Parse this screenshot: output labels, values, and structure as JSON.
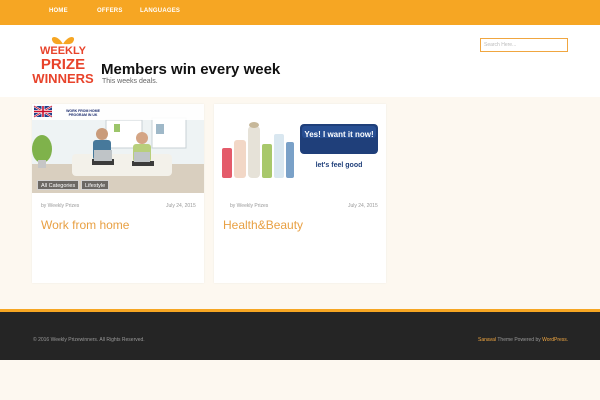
{
  "nav": {
    "items": [
      {
        "label": "HOME"
      },
      {
        "label": "OFFERS"
      },
      {
        "label": "LANGUAGES"
      }
    ]
  },
  "header": {
    "logo": {
      "line1": "WEEKLY",
      "line2": "PRIZE",
      "line3": "WINNERS"
    },
    "title": "Members win every week",
    "tagline": "This weeks deals.",
    "search_placeholder": "Search Here..."
  },
  "posts": [
    {
      "image_caption": "WORK FROM HOME PROGRAM IN UK",
      "categories": [
        "All Categories",
        "Lifestyle"
      ],
      "author": "by Weekly Prizes",
      "date": "July 24, 2015",
      "title": "Work from home"
    },
    {
      "image_cta_main": "Yes! I want it now!",
      "image_cta_sub": "let's feel good",
      "author": "by Weekly Prizes",
      "date": "July 24, 2015",
      "title": "Health&Beauty"
    }
  ],
  "footer": {
    "copyright": "© 2016 Weekly Prizewinners. All Rights Reserved.",
    "theme_name": "Sanaval",
    "theme_mid": " Theme Powered by ",
    "platform": "WordPress."
  },
  "colors": {
    "accent": "#f6a623",
    "title_orange": "#e8a043",
    "footer_bg": "#252525",
    "page_bg": "#fdf8f0"
  }
}
